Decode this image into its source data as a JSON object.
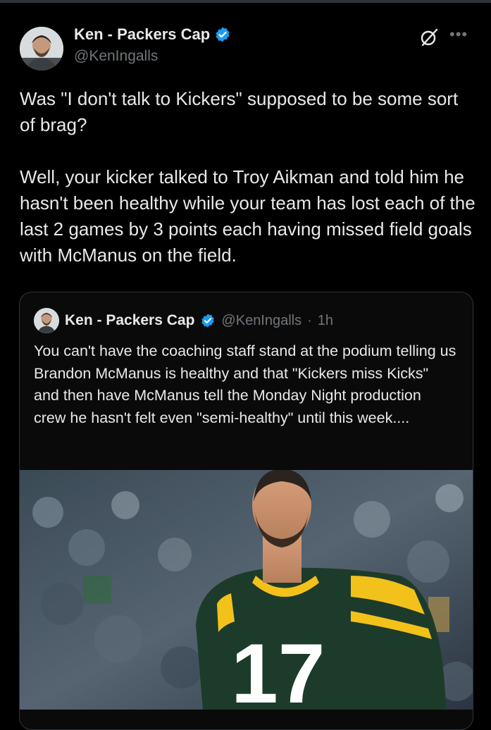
{
  "tweet": {
    "author_name": "Ken - Packers Cap",
    "author_handle": "@KenIngalls",
    "more_label": "•••",
    "text": "Was \"I don't talk to Kickers\" supposed to be some sort of brag?\n\nWell, your kicker talked to Troy Aikman and told him he hasn't been healthy while your team has lost each of the last 2 games by 3 points each having missed field goals with McManus on the field."
  },
  "quote": {
    "author_name": "Ken - Packers Cap",
    "author_handle": "@KenIngalls",
    "separator": "·",
    "time": "1h",
    "text": "You can't have the coaching staff stand at the podium telling us Brandon McManus is healthy and that \"Kickers miss Kicks\" and then have McManus tell the Monday Night production crew he hasn't felt even \"semi-healthy\" until this week....",
    "media": {
      "jersey_number": "17",
      "jersey_color": "#1d3b2a",
      "stripe_color": "#f2c21b"
    }
  },
  "colors": {
    "background": "#000000",
    "text": "#e7e9ea",
    "secondary": "#71767b",
    "verified": "#1d9bf0",
    "border": "#2f3336"
  },
  "icons": [
    "verified-badge-icon",
    "grok-icon",
    "more-options-icon"
  ]
}
